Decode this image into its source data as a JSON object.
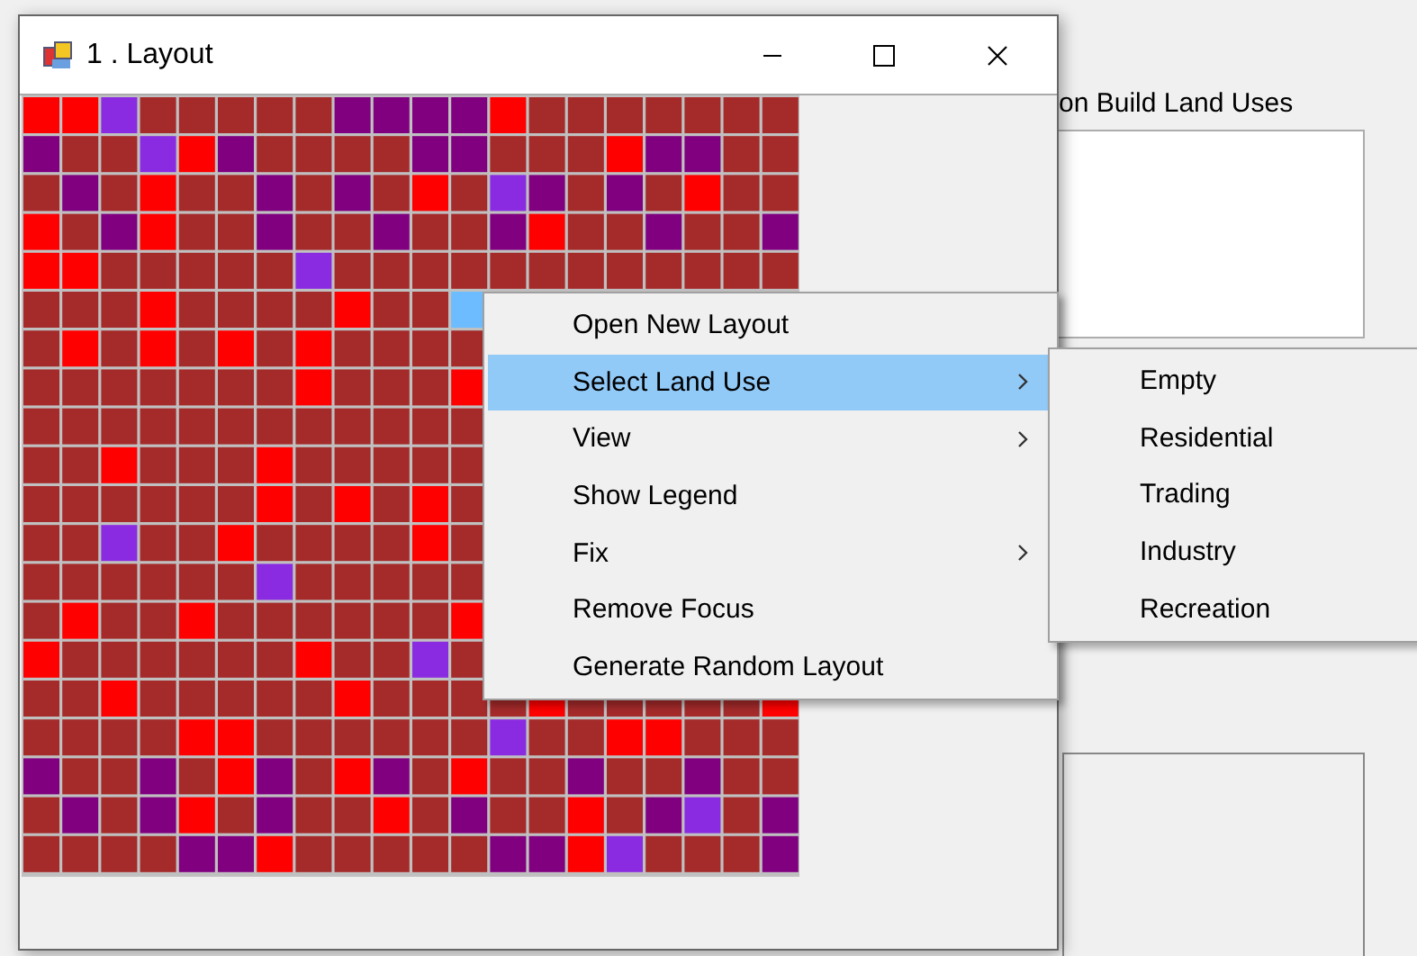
{
  "window": {
    "title": "1 . Layout"
  },
  "background_panel": {
    "label": "on Build Land Uses"
  },
  "context_menu": {
    "items": [
      {
        "label": "Open New Layout",
        "selected": false,
        "submenu": false
      },
      {
        "label": "Select Land Use",
        "selected": true,
        "submenu": true
      },
      {
        "label": "View",
        "selected": false,
        "submenu": true
      },
      {
        "label": "Show Legend",
        "selected": false,
        "submenu": false
      },
      {
        "label": "Fix",
        "selected": false,
        "submenu": true
      },
      {
        "label": "Remove Focus",
        "selected": false,
        "submenu": false
      },
      {
        "label": "Generate Random Layout",
        "selected": false,
        "submenu": false
      }
    ]
  },
  "submenu": {
    "items": [
      {
        "label": "Empty"
      },
      {
        "label": "Residential"
      },
      {
        "label": "Trading"
      },
      {
        "label": "Industry"
      },
      {
        "label": "Recreation"
      }
    ]
  }
}
